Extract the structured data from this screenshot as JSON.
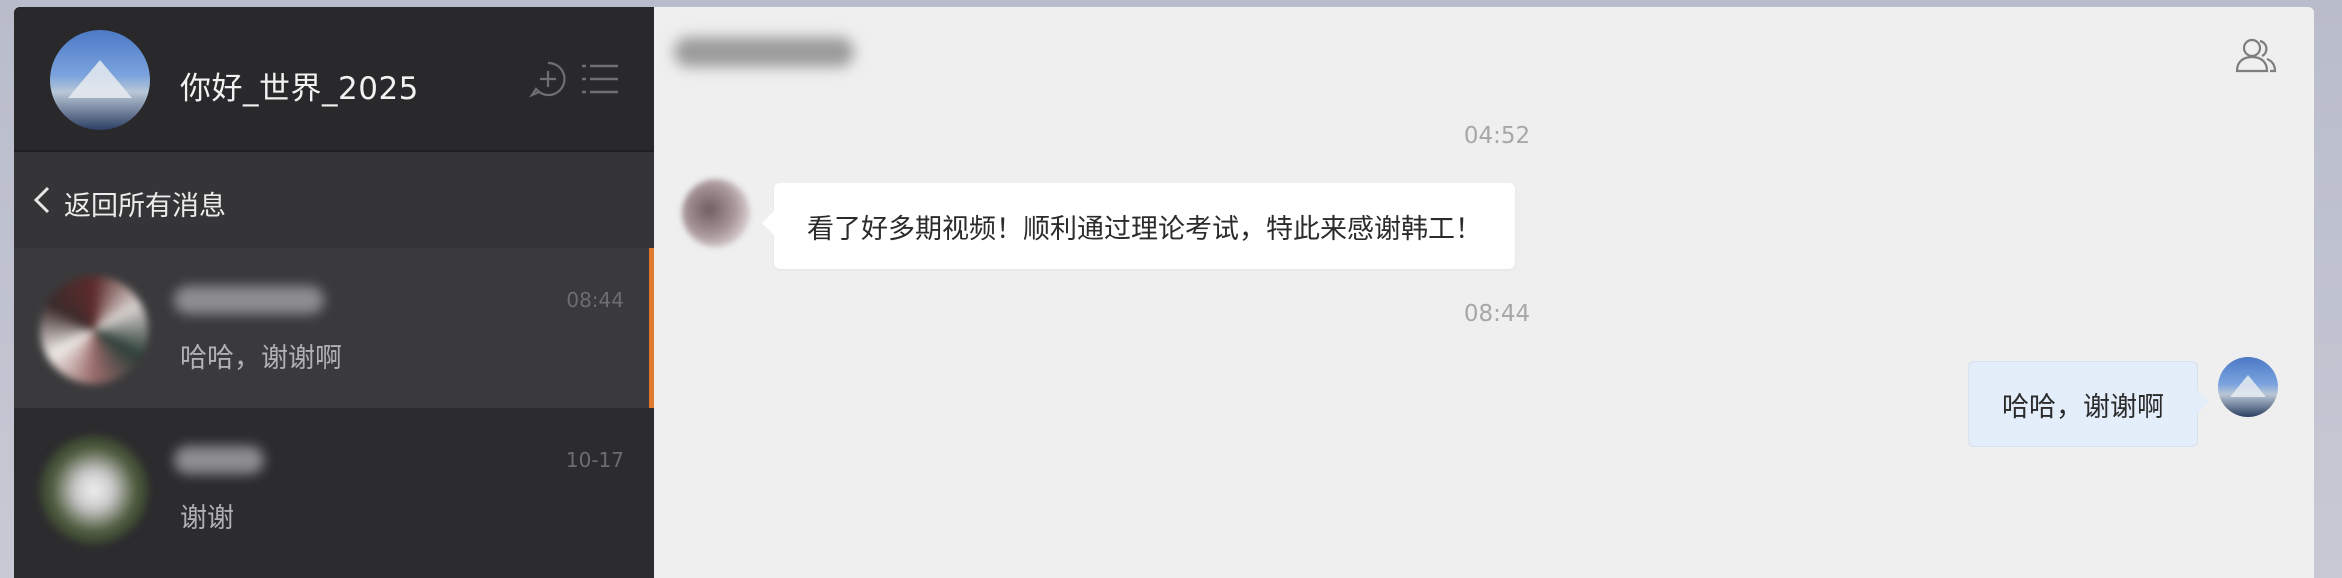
{
  "profile": {
    "name": "你好_世界_2025",
    "icons": {
      "new_chat": "plus-chat-icon",
      "menu": "menu-list-icon"
    }
  },
  "nav": {
    "back_label": "返回所有消息",
    "back_icon": "chevron-left-icon"
  },
  "conversations": [
    {
      "time": "08:44",
      "preview": "哈哈，谢谢啊",
      "active": true
    },
    {
      "time": "10-17",
      "preview": "谢谢",
      "active": false
    }
  ],
  "chat": {
    "header_icon": "members-icon",
    "messages": [
      {
        "timestamp": "04:52",
        "direction": "incoming",
        "text": "看了好多期视频！顺利通过理论考试，特此来感谢韩工！"
      },
      {
        "timestamp": "08:44",
        "direction": "outgoing",
        "text": "哈哈，谢谢啊"
      }
    ]
  },
  "colors": {
    "sidebar_bg": "#2c2c2e",
    "active_item_bg": "#3a3a3c",
    "active_accent": "#e17a2c",
    "chat_bg": "#efefef",
    "incoming_bubble": "#ffffff",
    "outgoing_bubble": "#e3eefa"
  }
}
